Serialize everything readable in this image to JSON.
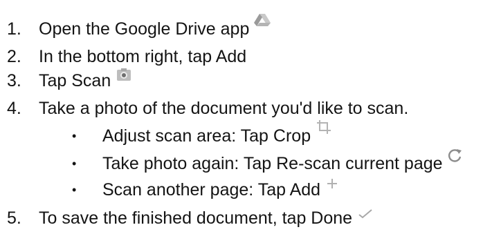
{
  "steps": [
    {
      "number": "1.",
      "text": "Open the Google Drive app",
      "icon": "google-drive-icon"
    },
    {
      "number": "2.",
      "text": "In the bottom  right, tap Add"
    },
    {
      "number": "3.",
      "text": "Tap Scan",
      "icon": "camera-scan-icon"
    },
    {
      "number": "4.",
      "text": "Take a photo of the document you'd like to scan."
    },
    {
      "number": "5.",
      "text": "To save the finished document, tap Done",
      "icon": "checkmark-icon"
    }
  ],
  "substeps": [
    {
      "bullet": "•",
      "text": "Adjust scan area: Tap Crop",
      "icon": "crop-icon"
    },
    {
      "bullet": "•",
      "text": "Take photo  again: Tap Re-scan current page",
      "icon": "rescan-icon"
    },
    {
      "bullet": "•",
      "text": "Scan another page: Tap Add",
      "icon": "add-icon"
    }
  ]
}
